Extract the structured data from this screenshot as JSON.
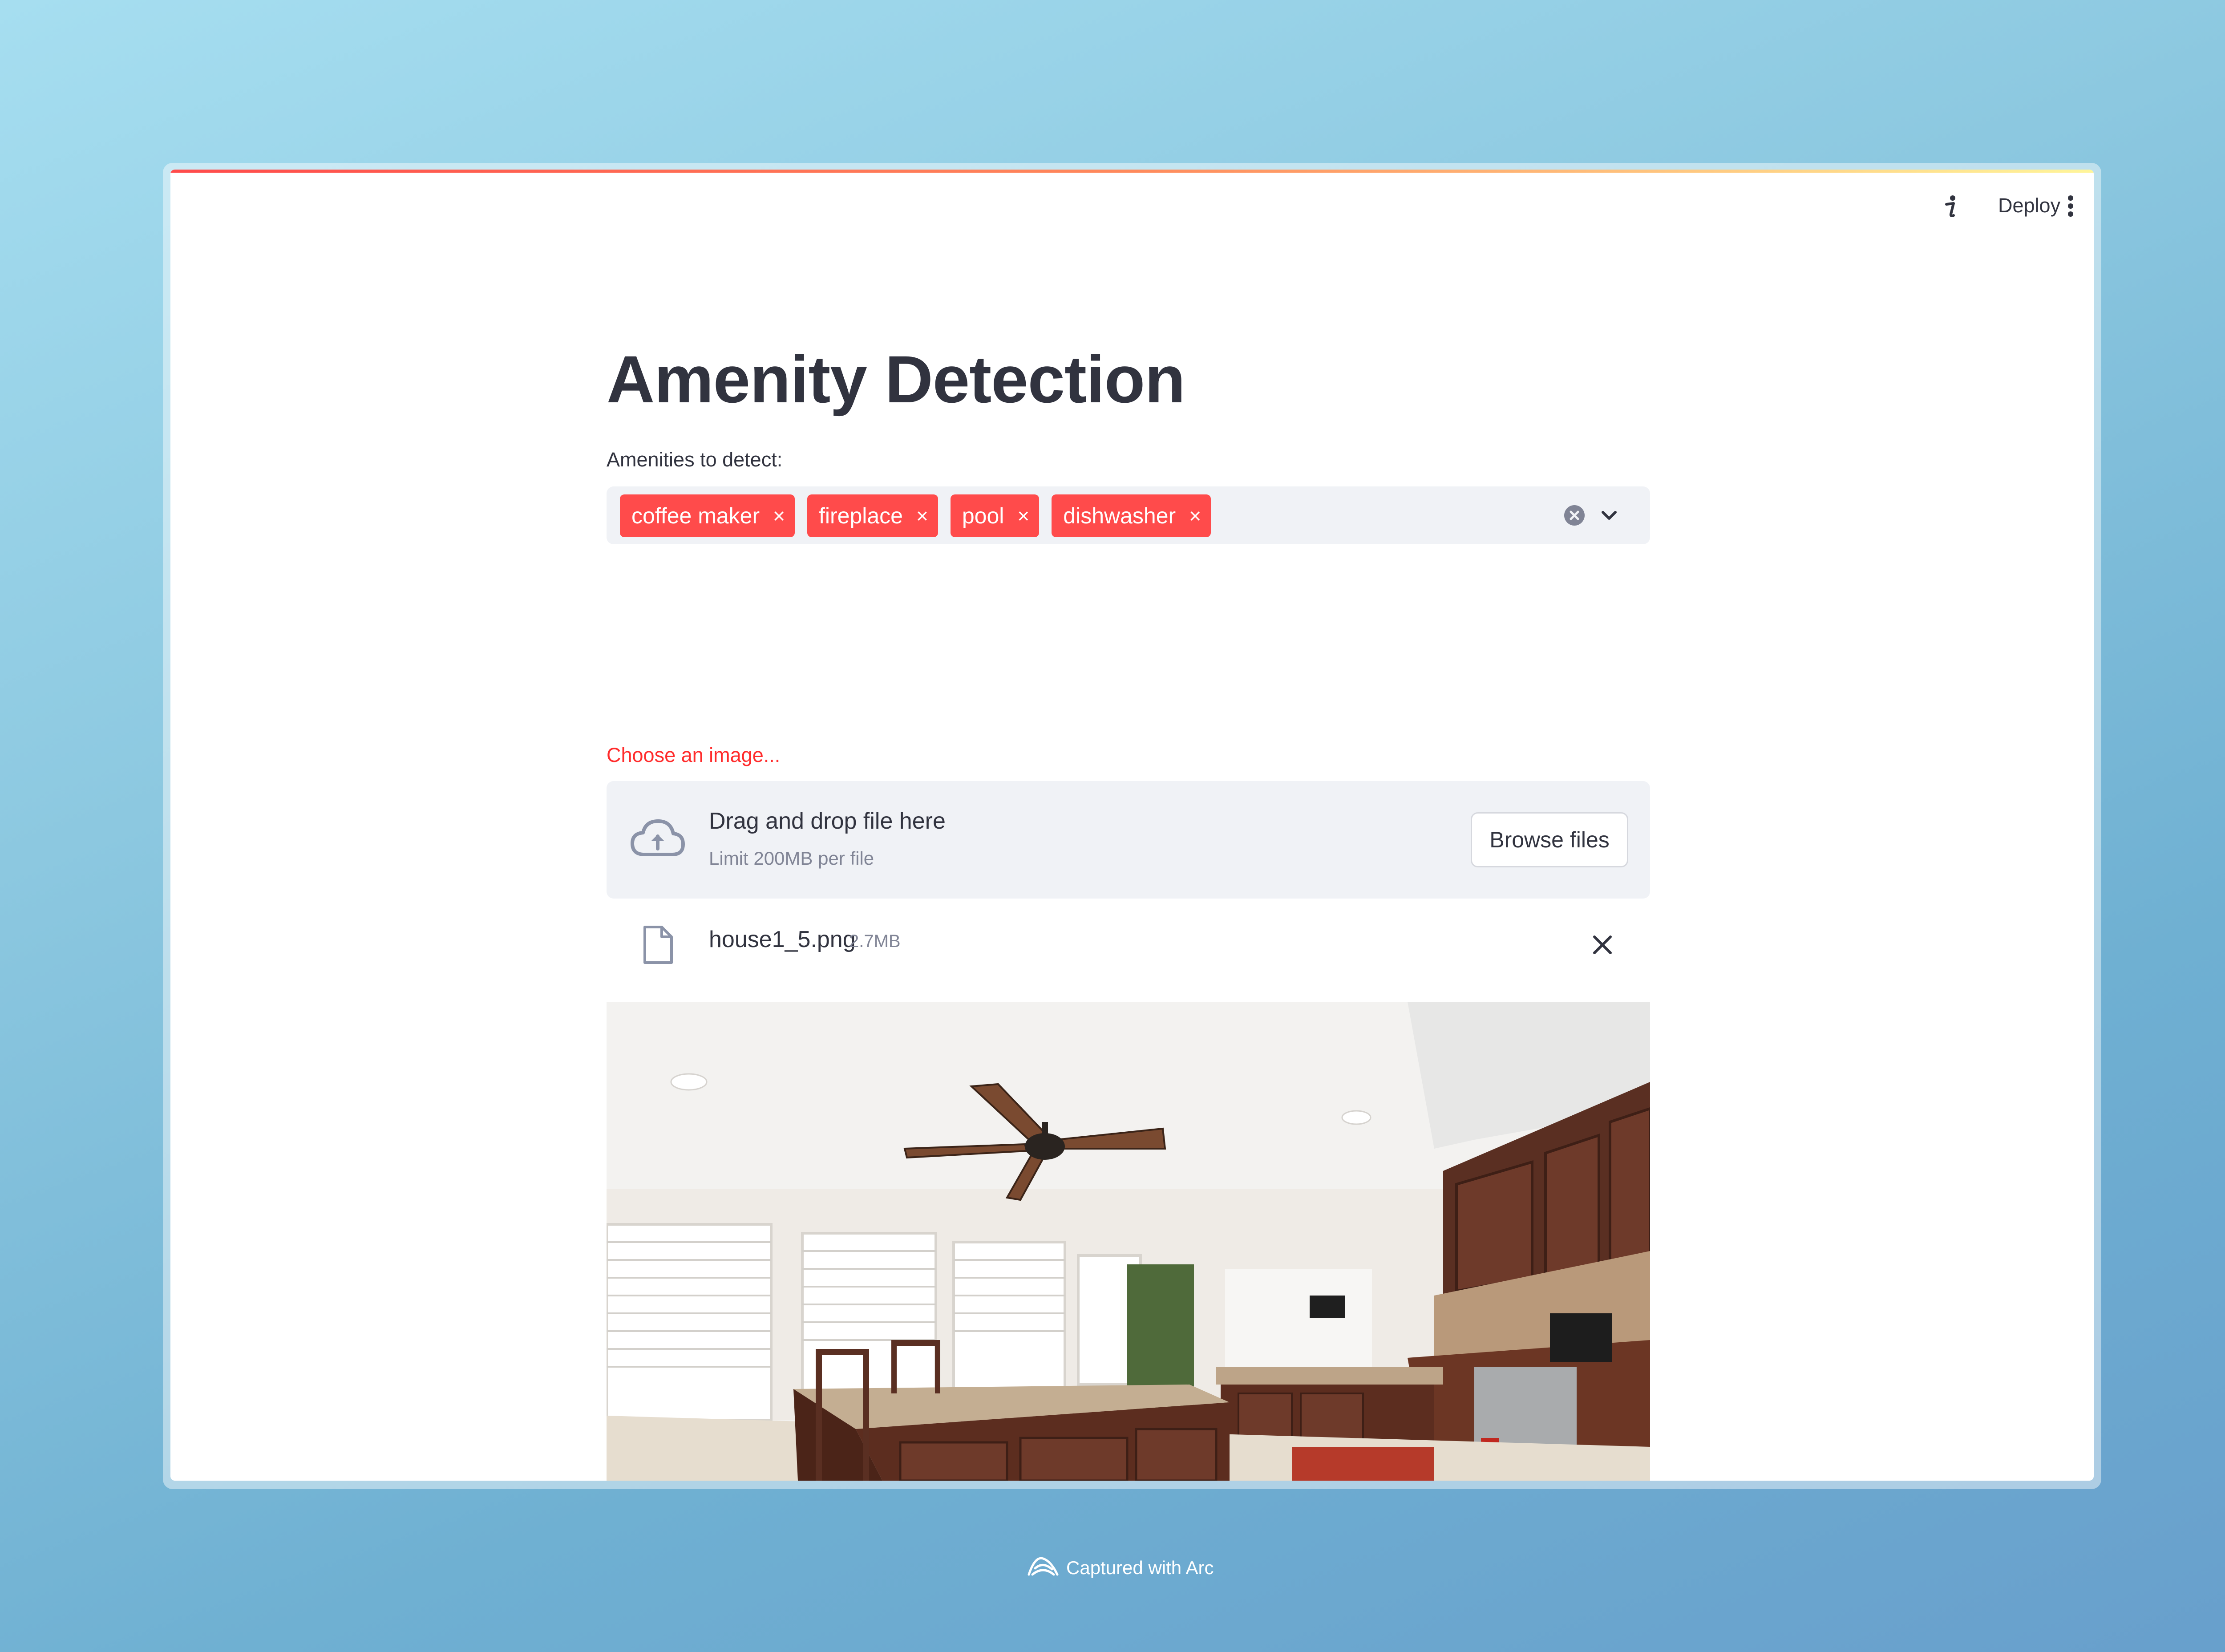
{
  "toolbar": {
    "deploy_label": "Deploy",
    "info_icon": "info-icon",
    "menu_icon": "kebab-menu-icon"
  },
  "main": {
    "title": "Amenity Detection",
    "multiselect": {
      "label": "Amenities to detect:",
      "selected": [
        {
          "label": "coffee maker",
          "remove": "×"
        },
        {
          "label": "fireplace",
          "remove": "×"
        },
        {
          "label": "pool",
          "remove": "×"
        },
        {
          "label": "dishwasher",
          "remove": "×"
        }
      ],
      "clear_icon": "clear-circle-icon",
      "chevron_icon": "chevron-down-icon",
      "chip_color": "#ff4b4b"
    },
    "uploader": {
      "label": "Choose an image...",
      "drop_title": "Drag and drop file here",
      "drop_subtitle": "Limit 200MB per file",
      "browse_label": "Browse files",
      "upload_icon": "cloud-upload-icon"
    },
    "uploaded_file": {
      "name": "house1_5.png",
      "size": "2.7MB",
      "file_icon": "document-icon",
      "remove_icon": "close-icon"
    },
    "preview_image": "kitchen-photo"
  },
  "footer": {
    "caption": "Captured with Arc",
    "arc_icon": "arc-logo-icon"
  },
  "colors": {
    "accent": "#ff4b4b",
    "label_red": "#ff2b2b",
    "input_bg": "#f0f2f6",
    "text": "#31333f",
    "muted": "#808495"
  }
}
